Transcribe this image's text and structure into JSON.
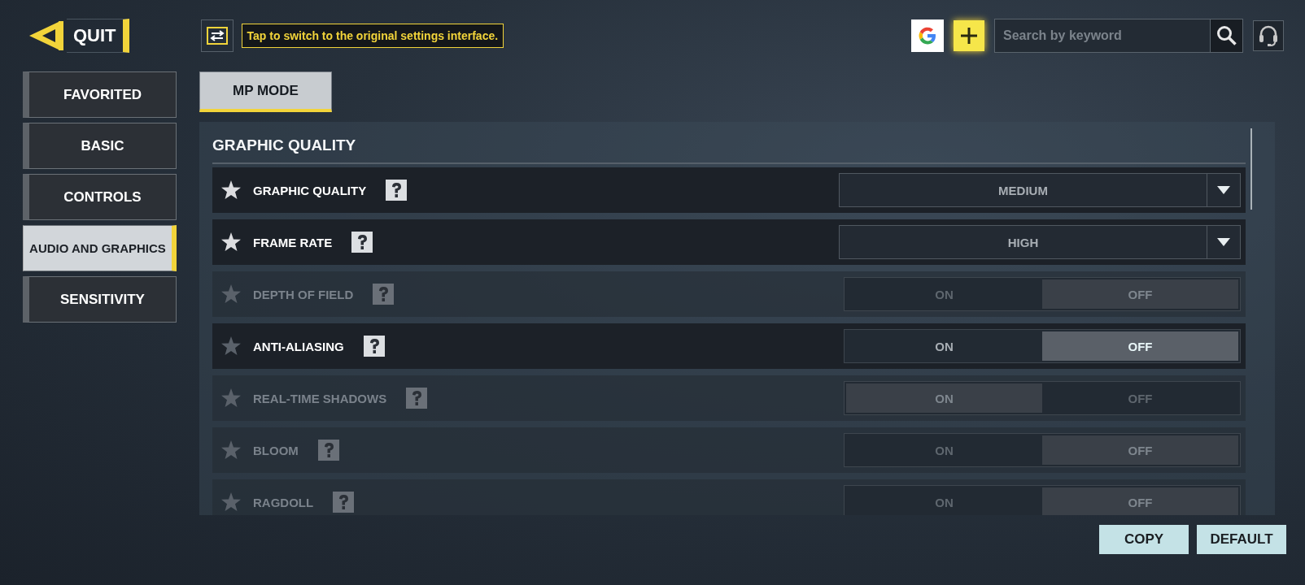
{
  "quit_button": {
    "label": "QUIT"
  },
  "switch_hint": {
    "text": "Tap to switch to the original settings interface."
  },
  "search": {
    "placeholder": "Search by keyword"
  },
  "sidebar": {
    "items": [
      {
        "label": "FAVORITED",
        "selected": false
      },
      {
        "label": "BASIC",
        "selected": false
      },
      {
        "label": "CONTROLS",
        "selected": false
      },
      {
        "label": "AUDIO AND GRAPHICS",
        "selected": true
      },
      {
        "label": "SENSITIVITY",
        "selected": false
      }
    ]
  },
  "mode_tabs": [
    {
      "label": "MP MODE",
      "selected": true
    }
  ],
  "section": {
    "title": "GRAPHIC QUALITY",
    "settings": [
      {
        "kind": "dropdown",
        "label": "GRAPHIC QUALITY",
        "favorite": true,
        "disabled": false,
        "value": "MEDIUM"
      },
      {
        "kind": "dropdown",
        "label": "FRAME RATE",
        "favorite": true,
        "disabled": false,
        "value": "HIGH"
      },
      {
        "kind": "toggle",
        "label": "DEPTH OF FIELD",
        "favorite": false,
        "disabled": true,
        "options": [
          {
            "label": "ON",
            "selected": false
          },
          {
            "label": "OFF",
            "selected": true
          }
        ]
      },
      {
        "kind": "toggle",
        "label": "ANTI-ALIASING",
        "favorite": false,
        "disabled": false,
        "options": [
          {
            "label": "ON",
            "selected": false
          },
          {
            "label": "OFF",
            "selected": true
          }
        ]
      },
      {
        "kind": "toggle",
        "label": "REAL-TIME SHADOWS",
        "favorite": false,
        "disabled": true,
        "options": [
          {
            "label": "ON",
            "selected": true
          },
          {
            "label": "OFF",
            "selected": false
          }
        ]
      },
      {
        "kind": "toggle",
        "label": "BLOOM",
        "favorite": false,
        "disabled": true,
        "options": [
          {
            "label": "ON",
            "selected": false
          },
          {
            "label": "OFF",
            "selected": true
          }
        ]
      },
      {
        "kind": "toggle",
        "label": "RAGDOLL",
        "favorite": false,
        "disabled": true,
        "options": [
          {
            "label": "ON",
            "selected": false
          },
          {
            "label": "OFF",
            "selected": true
          }
        ]
      }
    ]
  },
  "buttons": [
    {
      "label": "COPY"
    },
    {
      "label": "DEFAULT"
    }
  ]
}
